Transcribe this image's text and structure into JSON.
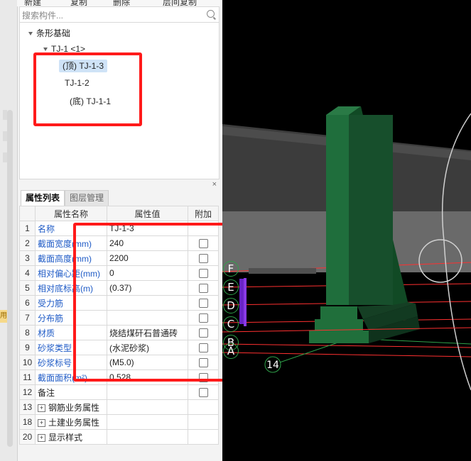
{
  "toolbar": {
    "new_label": "新建",
    "copy_label": "复制",
    "delete_label": "删除",
    "layer_copy_label": "层间复制"
  },
  "search": {
    "placeholder": "搜索构件..."
  },
  "tree": {
    "root": "条形基础",
    "group": "TJ-1 <1>",
    "items": [
      {
        "label": "(顶) TJ-1-3",
        "selected": true
      },
      {
        "label": "TJ-1-2",
        "selected": false
      },
      {
        "label": "(底) TJ-1-1",
        "selected": false
      }
    ]
  },
  "left_strip": {
    "cut_text": "用"
  },
  "panel": {
    "close": "×"
  },
  "tabs": [
    {
      "label": "属性列表",
      "active": true
    },
    {
      "label": "图层管理",
      "active": false
    }
  ],
  "table": {
    "headers": {
      "num": "",
      "name": "属性名称",
      "value": "属性值",
      "extra": "附加"
    },
    "rows": [
      {
        "num": "1",
        "name": "名称",
        "value": "TJ-1-3",
        "checkbox": false,
        "blue": true
      },
      {
        "num": "2",
        "name": "截面宽度(mm)",
        "value": "240",
        "checkbox": true,
        "blue": true
      },
      {
        "num": "3",
        "name": "截面高度(mm)",
        "value": "2200",
        "checkbox": true,
        "blue": true
      },
      {
        "num": "4",
        "name": "相对偏心距(mm)",
        "value": "0",
        "checkbox": true,
        "blue": true
      },
      {
        "num": "5",
        "name": "相对底标高(m)",
        "value": "(0.37)",
        "checkbox": true,
        "blue": true
      },
      {
        "num": "6",
        "name": "受力筋",
        "value": "",
        "checkbox": true,
        "blue": true
      },
      {
        "num": "7",
        "name": "分布筋",
        "value": "",
        "checkbox": true,
        "blue": true
      },
      {
        "num": "8",
        "name": "材质",
        "value": "烧结煤矸石普通砖",
        "checkbox": true,
        "blue": true
      },
      {
        "num": "9",
        "name": "砂浆类型",
        "value": "(水泥砂浆)",
        "checkbox": true,
        "blue": true
      },
      {
        "num": "10",
        "name": "砂浆标号",
        "value": "(M5.0)",
        "checkbox": true,
        "blue": true
      },
      {
        "num": "11",
        "name": "截面面积(m²)",
        "value": "0.528",
        "checkbox": true,
        "blue": true
      },
      {
        "num": "12",
        "name": "备注",
        "value": "",
        "checkbox": true,
        "blue": false
      },
      {
        "num": "13",
        "name": "钢筋业务属性",
        "value": "",
        "checkbox": false,
        "blue": false,
        "expand": true
      },
      {
        "num": "18",
        "name": "土建业务属性",
        "value": "",
        "checkbox": false,
        "blue": false,
        "expand": true
      },
      {
        "num": "20",
        "name": "显示样式",
        "value": "",
        "checkbox": false,
        "blue": false,
        "expand": true
      }
    ]
  },
  "viewport": {
    "axis_labels": [
      "F",
      "E",
      "D",
      "C",
      "B",
      "A"
    ],
    "grid_number": "14"
  },
  "colors": {
    "highlight": "#ff1a1a",
    "selection": "#cfe3f7",
    "property_blue": "#1f5bc6",
    "wall_green": "#1f6e3c"
  }
}
